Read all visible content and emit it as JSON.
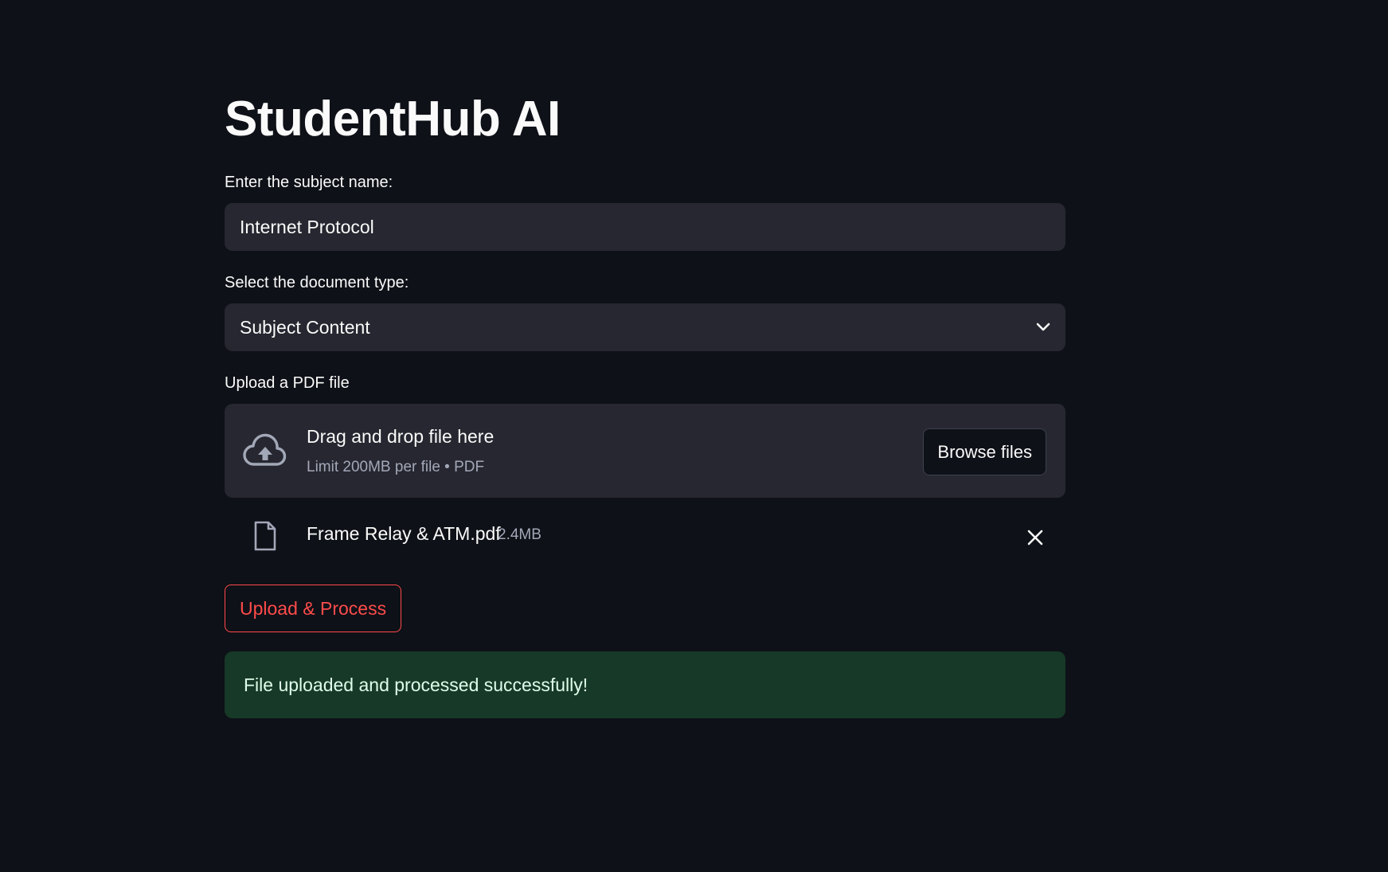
{
  "app": {
    "title": "StudentHub AI"
  },
  "subject": {
    "label": "Enter the subject name:",
    "value": "Internet Protocol"
  },
  "doc_type": {
    "label": "Select the document type:",
    "selected": "Subject Content",
    "icon": "chevron-down-icon"
  },
  "upload": {
    "label": "Upload a PDF file",
    "drop_title": "Drag and drop file here",
    "drop_subtitle": "Limit 200MB per file • PDF",
    "browse_label": "Browse files",
    "icon": "cloud-upload-icon"
  },
  "uploaded_file": {
    "name": "Frame Relay & ATM.pdf",
    "size": "2.4MB",
    "icon": "file-icon",
    "remove_icon": "close-icon"
  },
  "actions": {
    "process_label": "Upload & Process"
  },
  "alert": {
    "message": "File uploaded and processed successfully!"
  },
  "colors": {
    "background": "#0e1117",
    "surface": "#262730",
    "accent": "#ff4b4b",
    "success_bg": "#173928",
    "success_text": "#dffde9"
  }
}
